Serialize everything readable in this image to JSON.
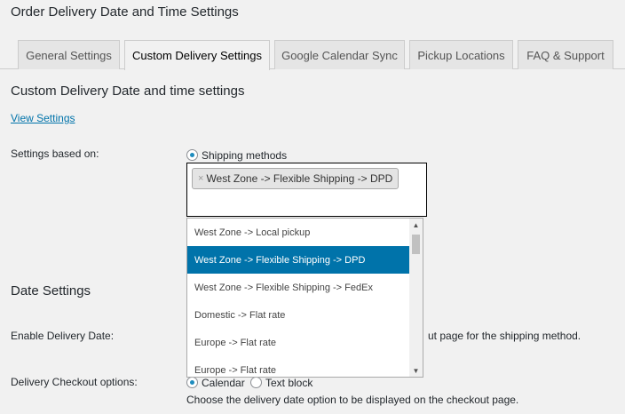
{
  "page": {
    "title": "Order Delivery Date and Time Settings"
  },
  "tabs": [
    {
      "label": "General Settings"
    },
    {
      "label": "Custom Delivery Settings"
    },
    {
      "label": "Google Calendar Sync"
    },
    {
      "label": "Pickup Locations"
    },
    {
      "label": "FAQ & Support"
    }
  ],
  "custom": {
    "heading": "Custom Delivery Date and time settings",
    "view_link": "View Settings",
    "settings_based_label": "Settings based on:",
    "shipping_methods_option": "Shipping methods",
    "selected_chip": "West Zone -> Flexible Shipping -> DPD",
    "chip_remove": "×"
  },
  "dropdown": {
    "items": [
      "West Zone -> Local pickup",
      "West Zone -> Flexible Shipping -> DPD",
      "West Zone -> Flexible Shipping -> FedEx",
      "Domestic -> Flat rate",
      "Europe -> Flat rate",
      "Europe -> Flat rate"
    ],
    "highlight_color": "#0073aa",
    "scroll_up": "▲",
    "scroll_down": "▼"
  },
  "date_settings": {
    "heading": "Date Settings",
    "enable_label": "Enable Delivery Date:",
    "enable_desc_partial": "ut page for the shipping method.",
    "checkout_label": "Delivery Checkout options:",
    "calendar_option": "Calendar",
    "text_block_option": "Text block",
    "checkout_desc": "Choose the delivery date option to be displayed on the checkout page."
  },
  "colors": {
    "link": "#0073aa",
    "background": "#f1f1f1"
  }
}
